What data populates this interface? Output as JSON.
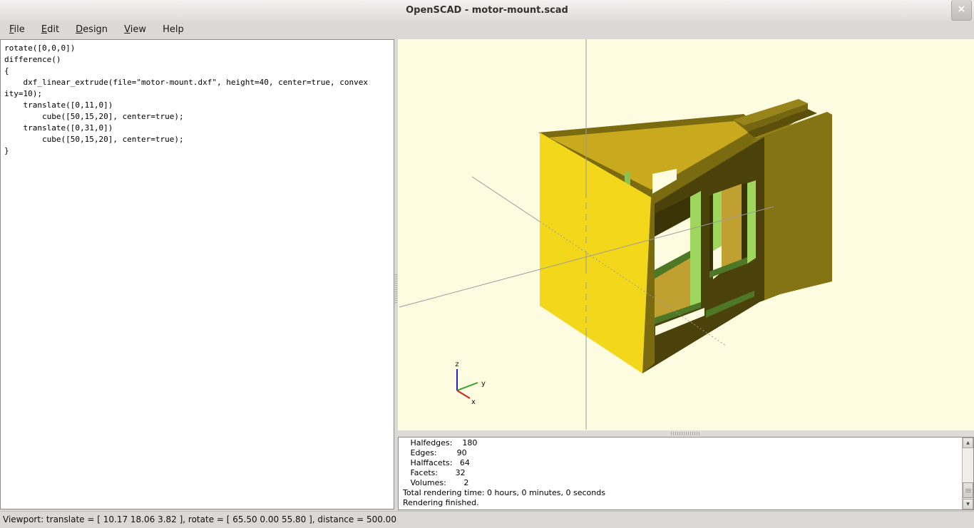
{
  "window": {
    "title": "OpenSCAD - motor-mount.scad",
    "close_glyph": "×"
  },
  "menu": {
    "items": [
      {
        "u": "F",
        "rest": "ile"
      },
      {
        "u": "E",
        "rest": "dit"
      },
      {
        "u": "D",
        "rest": "esign"
      },
      {
        "u": "V",
        "rest": "iew"
      },
      {
        "u": "",
        "rest": "Help"
      }
    ]
  },
  "editor": {
    "code_text": "rotate([0,0,0])\ndifference()\n{\n    dxf_linear_extrude(file=\"motor-mount.dxf\", height=40, center=true, convex\nity=10);\n    translate([0,11,0])\n        cube([50,15,20], center=true);\n    translate([0,31,0])\n        cube([50,15,20], center=true);\n}"
  },
  "viewport": {
    "axis_labels": {
      "x": "x",
      "y": "y",
      "z": "z"
    },
    "colors": {
      "background": "#fdfce1",
      "model_yellow": "#f2d71a",
      "model_top": "#c9a91d",
      "model_rim": "#7a6a10",
      "model_shadow": "#4a420a",
      "model_side": "#857414",
      "inner_gold": "#c1a032",
      "cut_green_light": "#9ed65e",
      "cut_green_dark": "#4e7826",
      "crosshair": "#9b9b9b",
      "axis_x": "#cc2222",
      "axis_y": "#2aa52a",
      "axis_z": "#2222cc"
    }
  },
  "console": {
    "lines": [
      "   Halfedges:    180",
      "   Edges:        90",
      "   Halffacets:   64",
      "   Facets:       32",
      "   Volumes:       2",
      "Total rendering time: 0 hours, 0 minutes, 0 seconds",
      "Rendering finished."
    ]
  },
  "statusbar": {
    "text": "Viewport: translate = [ 10.17 18.06 3.82 ], rotate = [ 65.50 0.00 55.80 ], distance = 500.00"
  }
}
